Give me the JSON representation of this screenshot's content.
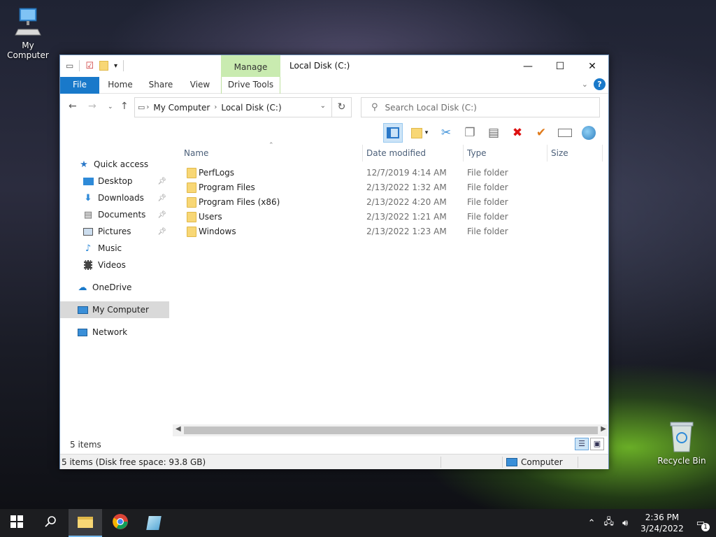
{
  "desktop": {
    "icons": [
      {
        "label": "My Computer"
      },
      {
        "label": "Recycle Bin"
      }
    ]
  },
  "window": {
    "title": "Local Disk (C:)",
    "contextual_tab_group": "Manage",
    "tabs": {
      "file": "File",
      "home": "Home",
      "share": "Share",
      "view": "View",
      "drive_tools": "Drive Tools"
    },
    "help_label": "?",
    "address": {
      "crumbs": [
        "My Computer",
        "Local Disk (C:)"
      ]
    },
    "search": {
      "placeholder": "Search Local Disk (C:)"
    },
    "nav_pane": {
      "quick_access": "Quick access",
      "items": [
        {
          "label": "Desktop",
          "pinned": true
        },
        {
          "label": "Downloads",
          "pinned": true
        },
        {
          "label": "Documents",
          "pinned": true
        },
        {
          "label": "Pictures",
          "pinned": true
        },
        {
          "label": "Music",
          "pinned": false
        },
        {
          "label": "Videos",
          "pinned": false
        }
      ],
      "onedrive": "OneDrive",
      "my_computer": "My Computer",
      "network": "Network"
    },
    "columns": {
      "name": "Name",
      "date_modified": "Date modified",
      "type": "Type",
      "size": "Size"
    },
    "files": [
      {
        "name": "PerfLogs",
        "date": "12/7/2019 4:14 AM",
        "type": "File folder"
      },
      {
        "name": "Program Files",
        "date": "2/13/2022 1:32 AM",
        "type": "File folder"
      },
      {
        "name": "Program Files (x86)",
        "date": "2/13/2022 4:20 AM",
        "type": "File folder"
      },
      {
        "name": "Users",
        "date": "2/13/2022 1:21 AM",
        "type": "File folder"
      },
      {
        "name": "Windows",
        "date": "2/13/2022 1:23 AM",
        "type": "File folder"
      }
    ],
    "items_count": "5 items",
    "status": {
      "left": "5 items (Disk free space: 93.8 GB)",
      "right": "Computer"
    }
  },
  "taskbar": {
    "time": "2:36 PM",
    "date": "3/24/2022",
    "notification_count": "1"
  },
  "colors": {
    "accent": "#1979ca",
    "manage_tab": "#c9ebb0",
    "folder": "#f8d775"
  }
}
